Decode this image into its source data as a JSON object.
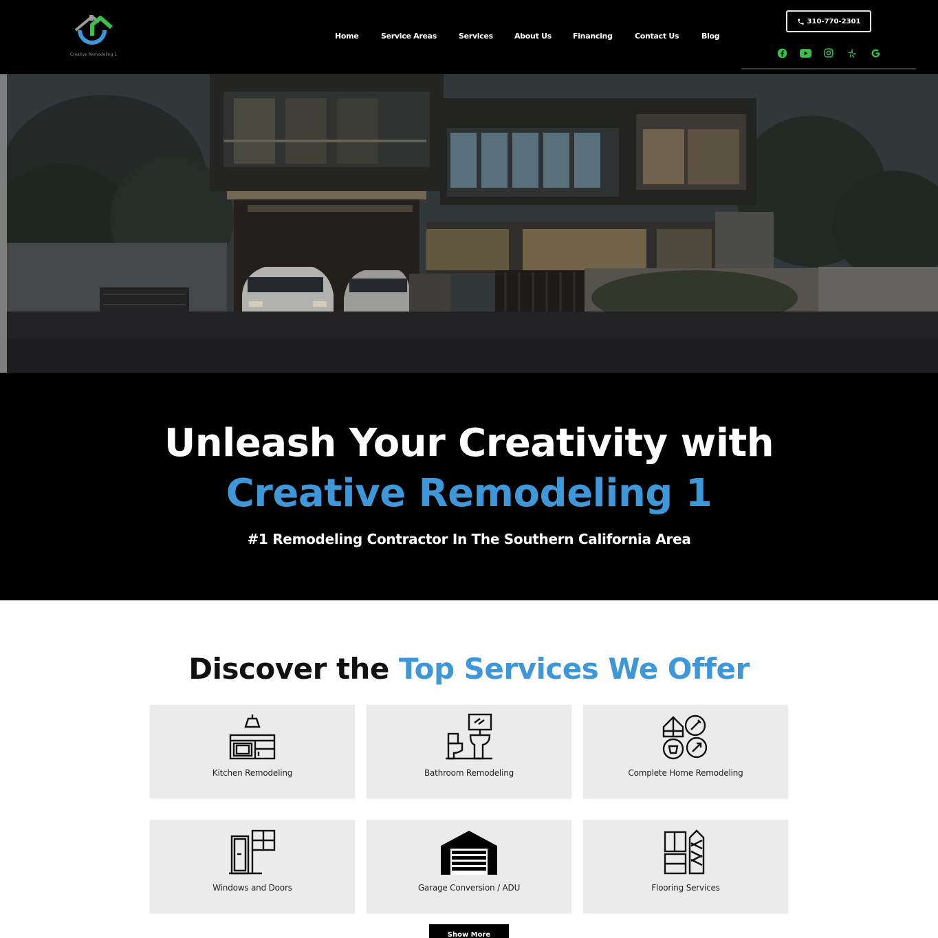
{
  "brand": {
    "name": "Creative Remodeling 1",
    "logo_text": "Creative Remodeling 1"
  },
  "nav": {
    "items": [
      {
        "label": "Home"
      },
      {
        "label": "Service Areas"
      },
      {
        "label": "Services"
      },
      {
        "label": "About Us"
      },
      {
        "label": "Financing"
      },
      {
        "label": "Contact Us"
      },
      {
        "label": "Blog"
      }
    ]
  },
  "contact": {
    "phone": "310-770-2301"
  },
  "socials": [
    {
      "icon": "facebook-icon"
    },
    {
      "icon": "youtube-icon"
    },
    {
      "icon": "instagram-icon"
    },
    {
      "icon": "yelp-icon"
    },
    {
      "icon": "google-icon"
    }
  ],
  "colors": {
    "accent_blue": "#3d97d8",
    "social_green": "#3ac04a",
    "header_bg": "#000000",
    "card_bg": "#ebebeb"
  },
  "hero": {
    "headline_line1": "Unleash Your Creativity with",
    "headline_line2": "Creative Remodeling 1",
    "subheadline": "#1 Remodeling Contractor In The Southern California Area"
  },
  "services": {
    "title_prefix": "Discover the ",
    "title_accent": "Top Services We Offer",
    "cards": [
      {
        "label": "Kitchen Remodeling",
        "icon": "kitchen-icon"
      },
      {
        "label": "Bathroom Remodeling",
        "icon": "bathroom-icon"
      },
      {
        "label": "Complete Home Remodeling",
        "icon": "home-remodel-icon"
      },
      {
        "label": "Windows and Doors",
        "icon": "window-door-icon"
      },
      {
        "label": "Garage Conversion / ADU",
        "icon": "garage-icon"
      },
      {
        "label": "Flooring Services",
        "icon": "flooring-icon"
      }
    ],
    "show_more_label": "Show More"
  }
}
